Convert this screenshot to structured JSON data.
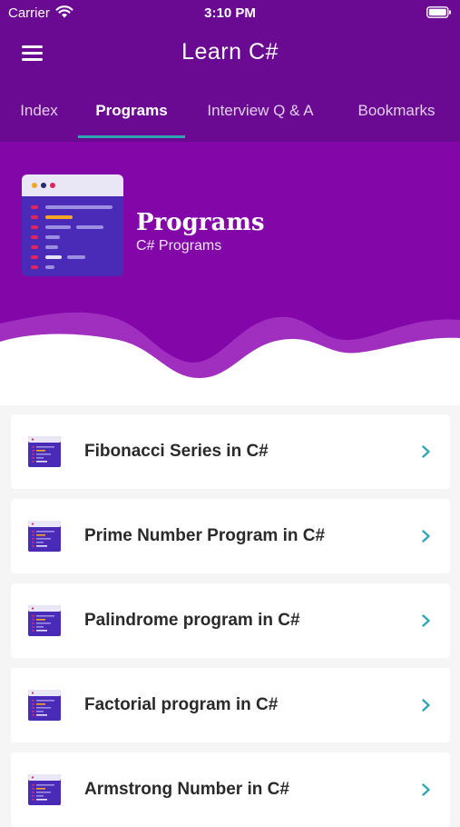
{
  "status_bar": {
    "carrier": "Carrier",
    "time": "3:10 PM",
    "icons": [
      "wifi-icon",
      "battery-icon"
    ]
  },
  "app_bar": {
    "title": "Learn C#",
    "menu_icon": "hamburger-menu-icon"
  },
  "tabs": [
    {
      "label": "Index",
      "active": false
    },
    {
      "label": "Programs",
      "active": true
    },
    {
      "label": "Interview Q & A",
      "active": false
    },
    {
      "label": "Bookmarks",
      "active": false
    }
  ],
  "hero": {
    "title": "Programs",
    "subtitle": "C# Programs",
    "icon": "code-editor-icon"
  },
  "list": {
    "items": [
      {
        "label": "Fibonacci Series in C#"
      },
      {
        "label": "Prime Number Program in C#"
      },
      {
        "label": "Palindrome program in C#"
      },
      {
        "label": "Factorial program in C#"
      },
      {
        "label": "Armstrong Number in C#"
      }
    ],
    "item_icon": "code-editor-icon",
    "trailing_icon": "chevron-right-icon"
  },
  "colors": {
    "app_bar": "#6a0a92",
    "hero": "#8306a8",
    "tab_indicator": "#2fa8b5",
    "chevron": "#2fa8b5",
    "background": "#f5f5f5"
  }
}
